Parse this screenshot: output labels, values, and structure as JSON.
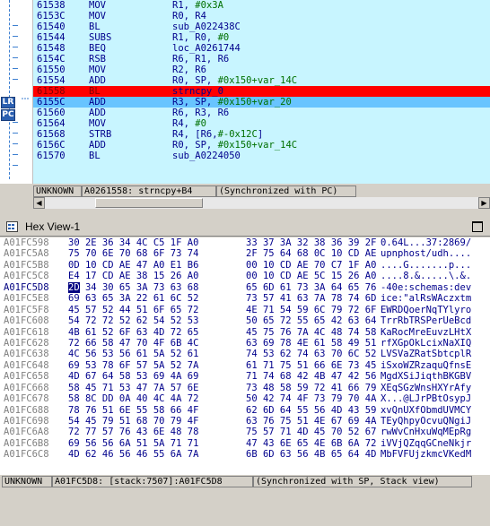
{
  "ida": {
    "lines": [
      {
        "addr": "61538",
        "mn": "MOV",
        "ops": [
          [
            "R1, ",
            "reg"
          ],
          [
            "#0x3A",
            "num"
          ]
        ],
        "hl": ""
      },
      {
        "addr": "6153C",
        "mn": "MOV",
        "ops": [
          [
            "R0, R4",
            "reg"
          ]
        ],
        "hl": ""
      },
      {
        "addr": "61540",
        "mn": "BL",
        "ops": [
          [
            "sub_A022438C",
            "reg"
          ]
        ],
        "hl": ""
      },
      {
        "addr": "61544",
        "mn": "SUBS",
        "ops": [
          [
            "R1, R0, ",
            "reg"
          ],
          [
            "#0",
            "num"
          ]
        ],
        "hl": ""
      },
      {
        "addr": "61548",
        "mn": "BEQ",
        "ops": [
          [
            "loc_A0261744",
            "reg"
          ]
        ],
        "hl": ""
      },
      {
        "addr": "6154C",
        "mn": "RSB",
        "ops": [
          [
            "R6, R1, R6",
            "reg"
          ]
        ],
        "hl": ""
      },
      {
        "addr": "61550",
        "mn": "MOV",
        "ops": [
          [
            "R2, R6",
            "reg"
          ]
        ],
        "hl": ""
      },
      {
        "addr": "61554",
        "mn": "ADD",
        "ops": [
          [
            "R0, SP, ",
            "reg"
          ],
          [
            "#0x150",
            "num"
          ],
          [
            "+var_14C",
            "num"
          ]
        ],
        "hl": ""
      },
      {
        "addr": "61558",
        "mn": "BL",
        "ops": [
          [
            "strncpy_0",
            "reg"
          ]
        ],
        "hl": "red"
      },
      {
        "addr": "6155C",
        "mn": "ADD",
        "ops": [
          [
            "R3, SP, ",
            "reg"
          ],
          [
            "#0x150",
            "num"
          ],
          [
            "+var_20",
            "num"
          ]
        ],
        "hl": "blue"
      },
      {
        "addr": "61560",
        "mn": "ADD",
        "ops": [
          [
            "R6, R3, R6",
            "reg"
          ]
        ],
        "hl": ""
      },
      {
        "addr": "61564",
        "mn": "MOV",
        "ops": [
          [
            "R4, ",
            "reg"
          ],
          [
            "#0",
            "num"
          ]
        ],
        "hl": ""
      },
      {
        "addr": "61568",
        "mn": "STRB",
        "ops": [
          [
            "R4, [R6,",
            "reg"
          ],
          [
            "#-0x12C",
            "num"
          ],
          [
            "]",
            "reg"
          ]
        ],
        "hl": ""
      },
      {
        "addr": "6156C",
        "mn": "ADD",
        "ops": [
          [
            "R0, SP, ",
            "reg"
          ],
          [
            "#0x150",
            "num"
          ],
          [
            "+var_14C",
            "num"
          ]
        ],
        "hl": ""
      },
      {
        "addr": "61570",
        "mn": "BL",
        "ops": [
          [
            "sub_A0224050",
            "reg"
          ]
        ],
        "hl": ""
      }
    ],
    "registers": [
      "LR",
      "PC"
    ],
    "status": {
      "mode": "UNKNOWN",
      "location": "A0261558: strncpy+B4",
      "sync": "(Synchronized with PC)"
    }
  },
  "hex": {
    "title": "Hex View-1",
    "rows": [
      {
        "addr": "A01FC598",
        "b1": "30 2E 36 34 4C C5 1F A0",
        "b2": "33 37 3A 32 38 36 39 2F",
        "asc": "0.64L...37:2869/"
      },
      {
        "addr": "A01FC5A8",
        "b1": "75 70 6E 70 68 6F 73 74",
        "b2": "2F 75 64 68 0C 10 CD AE",
        "asc": "upnphost/udh...."
      },
      {
        "addr": "A01FC5B8",
        "b1": "0D 10 CD AE 47 A0 E1 B6",
        "b2": "00 10 CD AE 70 C7 1F A0",
        "asc": "....G.......p..."
      },
      {
        "addr": "A01FC5C8",
        "b1": "E4 17 CD AE 38 15 26 A0",
        "b2": "00 10 CD AE 5C 15 26 A0",
        "asc": "....8.&.....\\.&."
      },
      {
        "addr": "A01FC5D8",
        "b1": "2D 34 30 65 3A 73 63 68",
        "b2": "65 6D 61 73 3A 64 65 76",
        "asc": "-40e:schemas:dev",
        "cur": true
      },
      {
        "addr": "A01FC5E8",
        "b1": "69 63 65 3A 22 61 6C 52",
        "b2": "73 57 41 63 7A 78 74 6D",
        "asc": "ice:\"alRsWAczxtm"
      },
      {
        "addr": "A01FC5F8",
        "b1": "45 57 52 44 51 6F 65 72",
        "b2": "4E 71 54 59 6C 79 72 6F",
        "asc": "EWRDQoerNqTYlyro"
      },
      {
        "addr": "A01FC608",
        "b1": "54 72 72 52 62 54 52 53",
        "b2": "50 65 72 55 65 42 63 64",
        "asc": "TrrRbTRSPerUeBcd"
      },
      {
        "addr": "A01FC618",
        "b1": "4B 61 52 6F 63 4D 72 65",
        "b2": "45 75 76 7A 4C 48 74 58",
        "asc": "KaRocMreEuvzLHtX"
      },
      {
        "addr": "A01FC628",
        "b1": "72 66 58 47 70 4F 6B 4C",
        "b2": "63 69 78 4E 61 58 49 51",
        "asc": "rfXGpOkLcixNaXIQ"
      },
      {
        "addr": "A01FC638",
        "b1": "4C 56 53 56 61 5A 52 61",
        "b2": "74 53 62 74 63 70 6C 52",
        "asc": "LVSVaZRatSbtcplR"
      },
      {
        "addr": "A01FC648",
        "b1": "69 53 78 6F 57 5A 52 7A",
        "b2": "61 71 75 51 66 6E 73 45",
        "asc": "iSxoWZRzaquQfnsE"
      },
      {
        "addr": "A01FC658",
        "b1": "4D 67 64 58 53 69 4A 69",
        "b2": "71 74 68 42 4B 47 42 56",
        "asc": "MgdXSiJiqthBKGBV"
      },
      {
        "addr": "A01FC668",
        "b1": "58 45 71 53 47 7A 57 6E",
        "b2": "73 48 58 59 72 41 66 79",
        "asc": "XEqSGzWnsHXYrAfy"
      },
      {
        "addr": "A01FC678",
        "b1": "58 8C DD 0A 40 4C 4A 72",
        "b2": "50 42 74 4F 73 79 70 4A",
        "asc": "X...@LJrPBtOsypJ"
      },
      {
        "addr": "A01FC688",
        "b1": "78 76 51 6E 55 58 66 4F",
        "b2": "62 6D 64 55 56 4D 43 59",
        "asc": "xvQnUXfObmdUVMCY"
      },
      {
        "addr": "A01FC698",
        "b1": "54 45 79 51 68 70 79 4F",
        "b2": "63 76 75 51 4E 67 69 4A",
        "asc": "TEyQhpyOcvuQNgiJ"
      },
      {
        "addr": "A01FC6A8",
        "b1": "72 77 57 76 43 6E 48 78",
        "b2": "75 57 71 4D 45 70 52 67",
        "asc": "rwWvCnHxuWqMEpRg"
      },
      {
        "addr": "A01FC6B8",
        "b1": "69 56 56 6A 51 5A 71 71",
        "b2": "47 43 6E 65 4E 6B 6A 72",
        "asc": "iVVjQZqqGCneNkjr"
      },
      {
        "addr": "A01FC6C8",
        "b1": "4D 62 46 56 46 55 6A 7A",
        "b2": "6B 6D 63 56 4B 65 64 4D",
        "asc": "MbFVFUjzkmcVKedM"
      }
    ],
    "status": {
      "mode": "UNKNOWN",
      "location": "A01FC5D8: [stack:7507]:A01FC5D8",
      "sync": "(Synchronized with SP, Stack view)"
    }
  },
  "colors": {
    "code_bg": "#c8f5ff",
    "current_pc": "#ff0000",
    "next_line": "#68c4ff",
    "text": "#00008c"
  }
}
